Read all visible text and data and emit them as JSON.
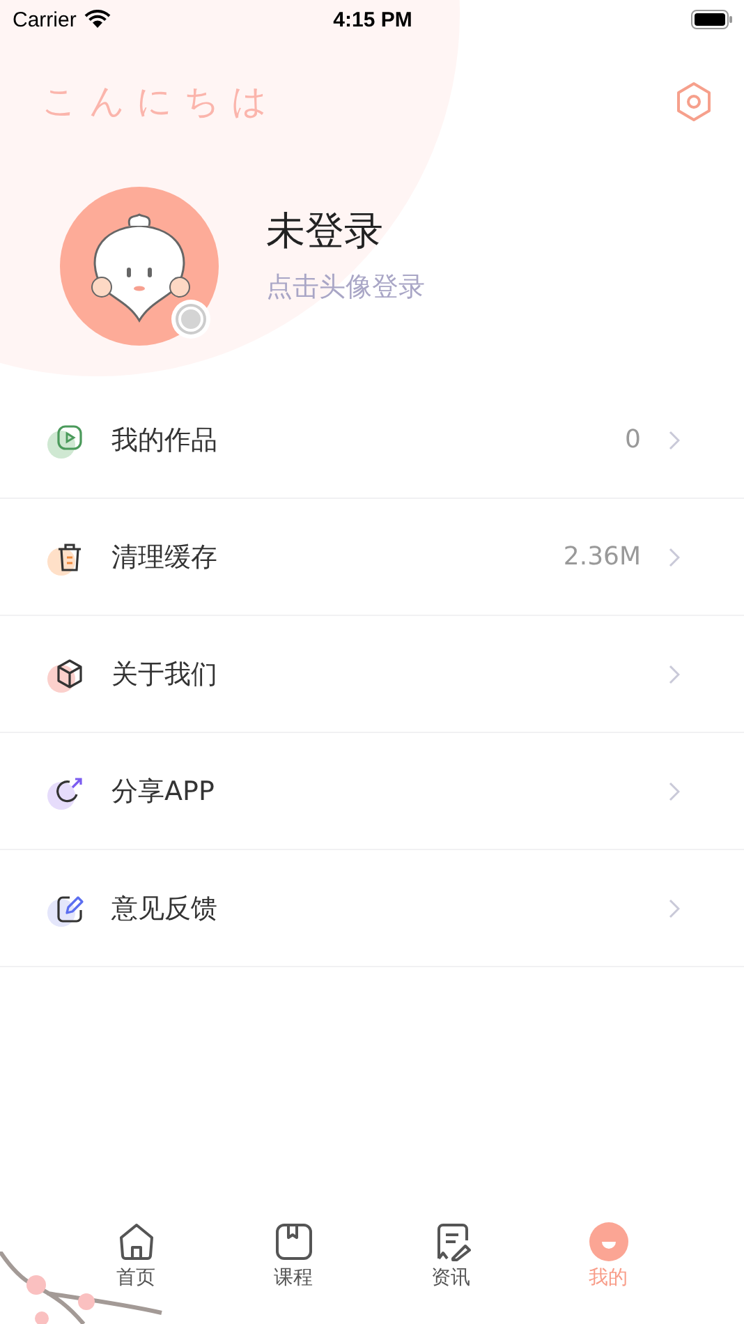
{
  "status_bar": {
    "carrier": "Carrier",
    "time": "4:15 PM"
  },
  "greeting": "こんにちは",
  "profile": {
    "name": "未登录",
    "hint": "点击头像登录"
  },
  "menu": [
    {
      "kind": "works",
      "label": "我的作品",
      "value": "0"
    },
    {
      "kind": "trash",
      "label": "清理缓存",
      "value": "2.36M"
    },
    {
      "kind": "cube",
      "label": "关于我们"
    },
    {
      "kind": "share",
      "label": "分享APP"
    },
    {
      "kind": "edit",
      "label": "意见反馈"
    }
  ],
  "tabs": [
    {
      "kind": "home",
      "label": "首页",
      "selected": false
    },
    {
      "kind": "course",
      "label": "课程",
      "selected": false
    },
    {
      "kind": "news",
      "label": "资讯",
      "selected": false
    },
    {
      "kind": "me",
      "label": "我的",
      "selected": true
    }
  ]
}
